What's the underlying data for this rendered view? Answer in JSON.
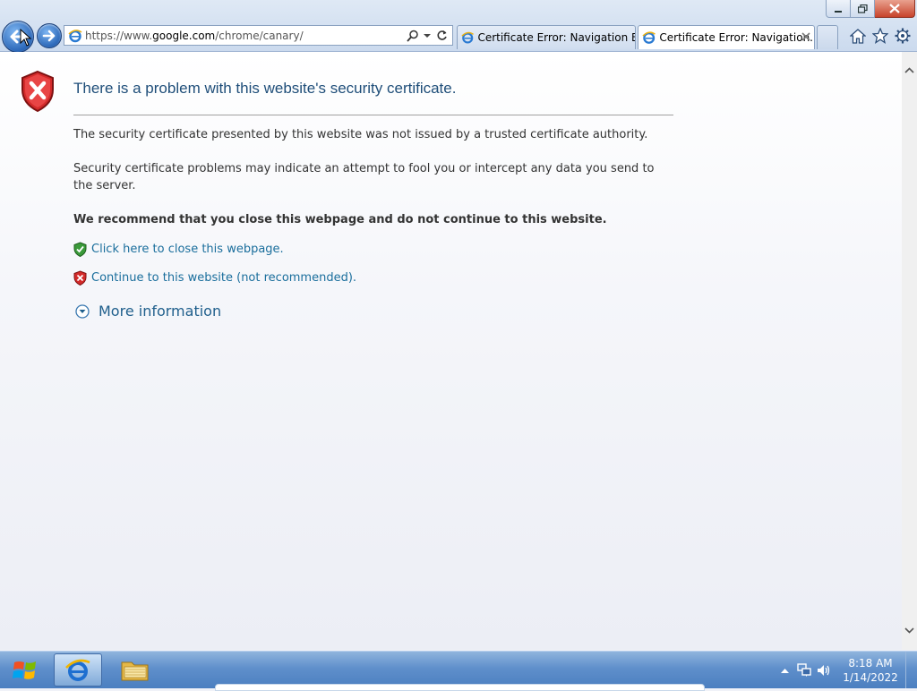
{
  "browser": {
    "address_prefix": "https://www.",
    "address_domain": "google.com",
    "address_suffix": "/chrome/canary/",
    "tabs": [
      {
        "label": "Certificate Error: Navigation Bl..."
      },
      {
        "label": "Certificate Error: Navigation..."
      }
    ]
  },
  "page": {
    "title": "There is a problem with this website's security certificate.",
    "para1": "The security certificate presented by this website was not issued by a trusted certificate authority.",
    "para2": "Security certificate problems may indicate an attempt to fool you or intercept any data you send to the server.",
    "recommendation": "We recommend that you close this webpage and do not continue to this website.",
    "close_link": "Click here to close this webpage.",
    "continue_link": "Continue to this website (not recommended).",
    "more_info": "More information"
  },
  "taskbar": {
    "time": "8:18 AM",
    "date": "1/14/2022"
  },
  "colors": {
    "title_blue": "#1f4e79",
    "link_blue": "#1a6e9c",
    "error_red": "#c62828",
    "safe_green": "#2e8b2e"
  }
}
